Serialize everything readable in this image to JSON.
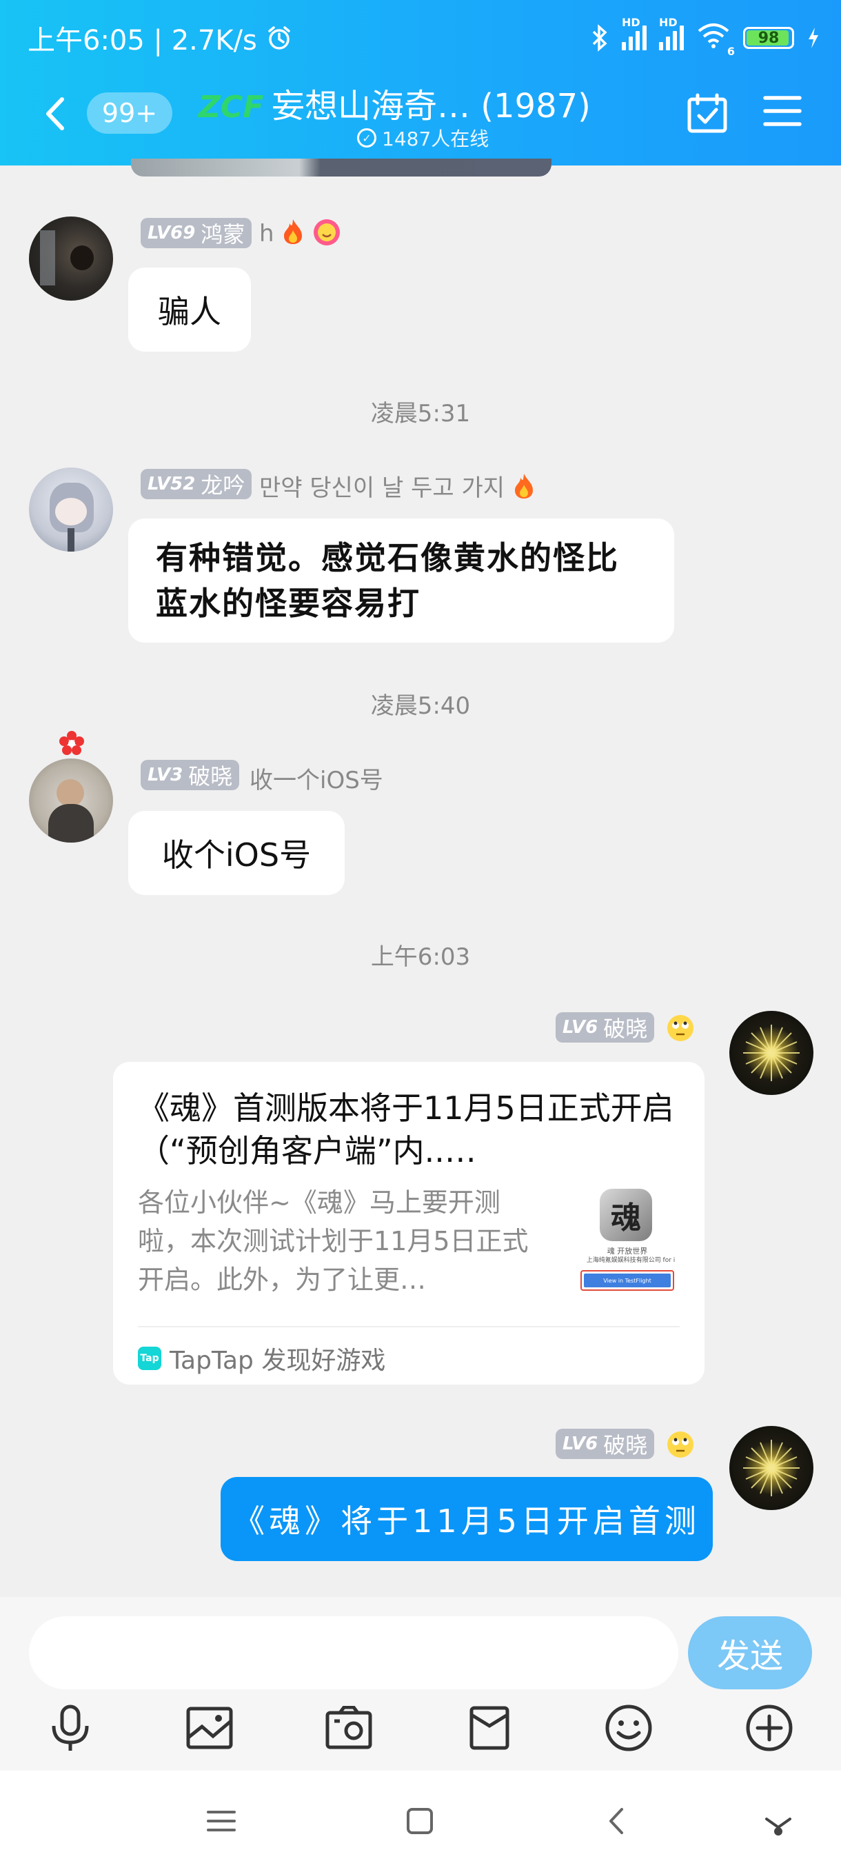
{
  "status_bar": {
    "time_speed": "上午6:05 | 2.7K/s",
    "battery": "98",
    "network_1": "HD",
    "network_2": "HD",
    "wifi_sub": "6"
  },
  "header": {
    "unread_badge": "99+",
    "logo_text": "ZCF",
    "title": "妄想山海奇… (1987)",
    "online": "1487人在线"
  },
  "messages": [
    {
      "level": "LV69",
      "name": "鸿蒙",
      "signature": "h",
      "text": "骗人"
    },
    {
      "time": "凌晨5:31"
    },
    {
      "level": "LV52",
      "name": "龙吟",
      "signature": "만약 당신이 날 두고 가지",
      "text": "有种错觉。感觉石像黄水的怪比蓝水的怪要容易打"
    },
    {
      "time": "凌晨5:40"
    },
    {
      "level": "LV3",
      "name": "破晓",
      "signature": "收一个iOS号",
      "text": "收个iOS号"
    },
    {
      "time": "上午6:03"
    },
    {
      "level": "LV6",
      "name": "破晓",
      "card": {
        "title": "《魂》首测版本将于11月5日正式开启（“预创角客户端”内..…",
        "desc": "各位小伙伴~《魂》马上要开测啦，本次测试计划于11月5日正式开启。此外，为了让更…",
        "thumb_caption_1": "魂 开放世界",
        "thumb_caption_2": "上海纯氪娱娱科技有限公司 for i",
        "thumb_button": "View in TestFlight",
        "thumb_glyph": "魂",
        "source": "TapTap 发现好游戏",
        "source_icon": "Tap"
      }
    },
    {
      "level": "LV6",
      "name": "破晓",
      "text": "《魂》将于11月5日开启首测"
    }
  ],
  "input": {
    "placeholder": "",
    "send_label": "发送"
  },
  "colors": {
    "header_start": "#18c3f5",
    "header_end": "#1a9bfb",
    "my_bubble": "#0a96f8",
    "send_button": "#7cc8f7",
    "level_badge": "#b8bcc6"
  },
  "icons": [
    "back-icon",
    "calendar-check-icon",
    "menu-icon",
    "microphone-icon",
    "image-icon",
    "camera-icon",
    "red-packet-icon",
    "emoji-icon",
    "plus-icon",
    "nav-menu-icon",
    "nav-home-icon",
    "nav-back-icon",
    "assistant-icon"
  ]
}
